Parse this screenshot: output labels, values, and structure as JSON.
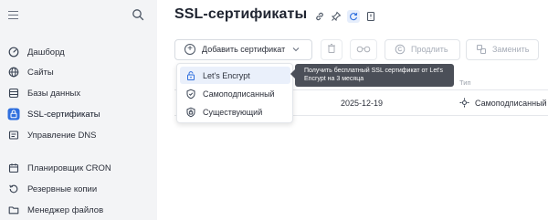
{
  "sidebar": {
    "items": [
      {
        "label": "Дашборд",
        "icon": "dashboard-icon"
      },
      {
        "label": "Сайты",
        "icon": "globe-icon"
      },
      {
        "label": "Базы данных",
        "icon": "database-icon"
      },
      {
        "label": "SSL-сертификаты",
        "icon": "lock-icon",
        "active": true
      },
      {
        "label": "Управление DNS",
        "icon": "dns-icon"
      },
      {
        "label": "Планировщик CRON",
        "icon": "calendar-icon"
      },
      {
        "label": "Резервные копии",
        "icon": "backup-icon"
      },
      {
        "label": "Менеджер файлов",
        "icon": "folder-icon"
      }
    ]
  },
  "header": {
    "title": "SSL-сертификаты"
  },
  "toolbar": {
    "add_label": "Добавить сертификат",
    "renew_label": "Продлить",
    "replace_label": "Заменить"
  },
  "table": {
    "type_header": "Тип",
    "rows": [
      {
        "date": "2025-12-19",
        "type": "Самоподписанный"
      }
    ]
  },
  "dropdown": {
    "items": [
      {
        "label": "Let's Encrypt",
        "icon": "lets-encrypt-icon"
      },
      {
        "label": "Самоподписанный",
        "icon": "self-signed-shield-icon"
      },
      {
        "label": "Существующий",
        "icon": "existing-shield-icon"
      }
    ]
  },
  "tooltip": {
    "text": "Получить бесплатный SSL сертификат от Let's Encrypt на 3 месяца"
  },
  "colors": {
    "accent": "#2f6fde",
    "sidebar_bg": "#f3f4f6",
    "tooltip_bg": "#4b4f58",
    "hover_bg": "#eaf0fb"
  }
}
